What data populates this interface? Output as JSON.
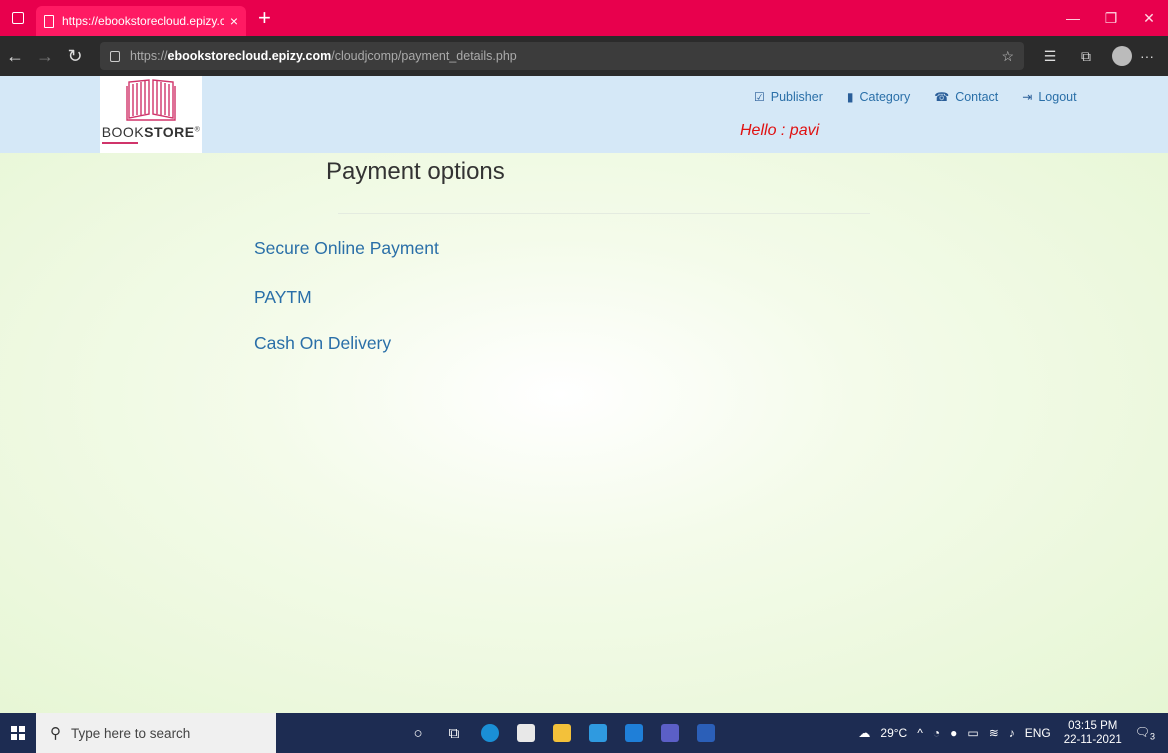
{
  "browser": {
    "tab_title": "https://ebookstorecloud.epizy.co",
    "tab_close": "×",
    "new_tab": "+",
    "url_prefix": "https://",
    "url_host": "ebookstorecloud.epizy.com",
    "url_path": "/cloudjcomp/payment_details.php",
    "accent_color": "#e8004d"
  },
  "site": {
    "logo_text_normal": "BOOK",
    "logo_text_bold": "STORE",
    "logo_mark": "®",
    "nav": [
      {
        "label": "Publisher",
        "icon": "check-square-icon"
      },
      {
        "label": "Category",
        "icon": "book-icon"
      },
      {
        "label": "Contact",
        "icon": "phone-icon"
      },
      {
        "label": "Logout",
        "icon": "logout-icon"
      }
    ],
    "greeting": "Hello : pavi"
  },
  "content": {
    "heading": "Payment options",
    "options": [
      "Secure Online Payment",
      "PAYTM",
      "Cash On Delivery"
    ]
  },
  "taskbar": {
    "search_placeholder": "Type here to search",
    "weather": "29°C",
    "language": "ENG",
    "time": "03:15 PM",
    "date": "22-11-2021",
    "notifications": "3"
  }
}
